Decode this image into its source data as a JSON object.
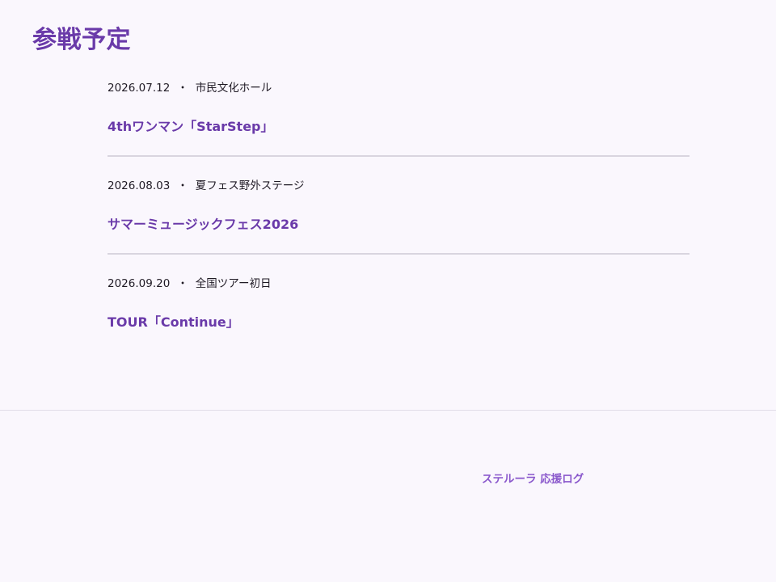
{
  "page": {
    "title": "参戦予定"
  },
  "events": [
    {
      "date": "2026.07.12",
      "separator": "・",
      "venue": "市民文化ホール",
      "title": "4thワンマン「StarStep」"
    },
    {
      "date": "2026.08.03",
      "separator": "・",
      "venue": "夏フェス野外ステージ",
      "title": "サマーミュージックフェス2026"
    },
    {
      "date": "2026.09.20",
      "separator": "・",
      "venue": "全国ツアー初日",
      "title": "TOUR「Continue」"
    }
  ],
  "footer": {
    "brand": "ステルーラ 応援ログ"
  },
  "colors": {
    "accent": "#6a3aa9",
    "footer_text": "#8a58cc",
    "background": "#faf7fd",
    "divider": "#d9d5df"
  }
}
